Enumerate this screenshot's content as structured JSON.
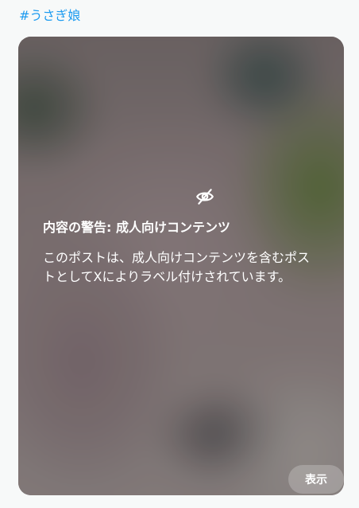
{
  "hashtag": "#うさぎ娘",
  "sensitive_media": {
    "icon": "eye-slash-icon",
    "title": "内容の警告: 成人向けコンテンツ",
    "body": "このポストは、成人向けコンテンツを含むポストとしてXによりラベル付けされています。",
    "show_button_label": "表示"
  },
  "colors": {
    "link": "#1d9bf0",
    "background": "#f7f9f9"
  }
}
